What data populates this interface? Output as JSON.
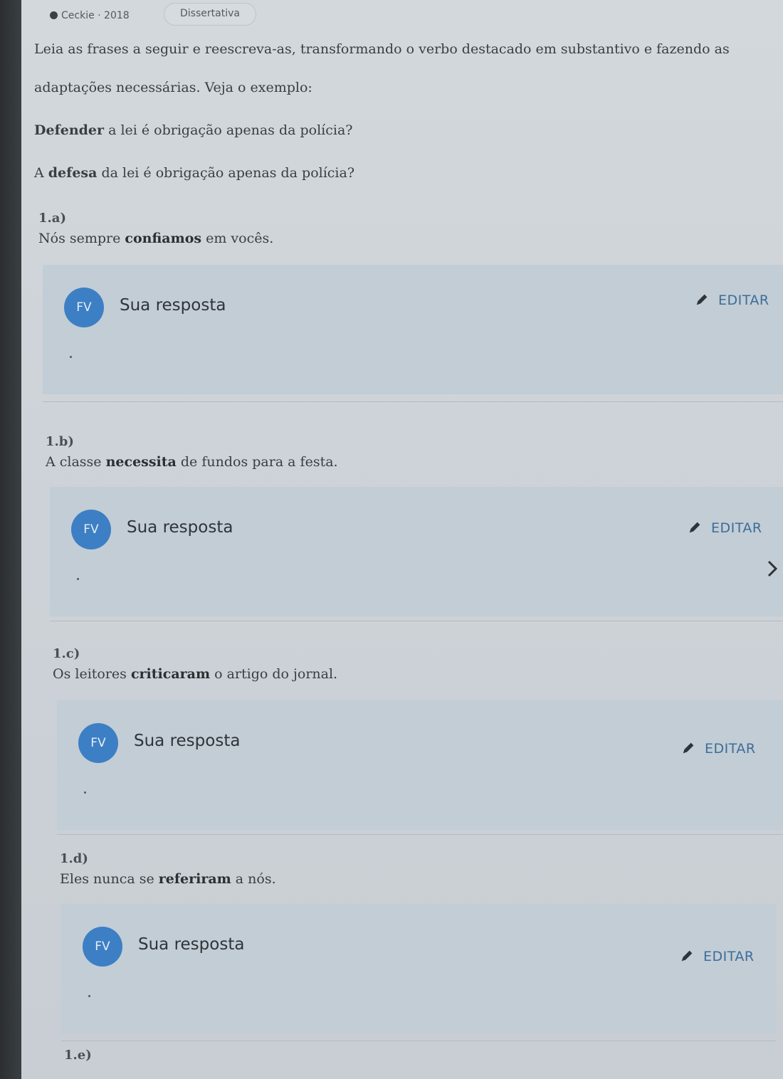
{
  "header": {
    "course": "Ceckie · 2018",
    "type_pill": "Dissertativa"
  },
  "instructions": {
    "line1": "Leia as frases a seguir e reescreva-as, transformando o verbo destacado em substantivo e fazendo as",
    "line2": "adaptações necessárias. Veja o exemplo:",
    "example_q_bold": "Defender",
    "example_q_rest": " a lei é obrigação apenas da polícia?",
    "example_a_pre": "A ",
    "example_a_bold": "defesa",
    "example_a_rest": " da lei é obrigação apenas da polícia?"
  },
  "questions": [
    {
      "label": "1.a)",
      "pre": "Nós sempre ",
      "bold": "confiamos",
      "post": " em vocês."
    },
    {
      "label": "1.b)",
      "pre": "A classe ",
      "bold": "necessita",
      "post": " de fundos para a festa."
    },
    {
      "label": "1.c)",
      "pre": "Os leitores ",
      "bold": "criticaram",
      "post": " o artigo do jornal."
    },
    {
      "label": "1.d)",
      "pre": "Eles nunca se ",
      "bold": "referiram",
      "post": " a nós."
    },
    {
      "label": "1.e)",
      "pre": "",
      "bold": "",
      "post": ""
    }
  ],
  "answer": {
    "avatar": "FV",
    "title": "Sua resposta",
    "edit_label": "EDITAR"
  },
  "colors": {
    "accent": "#3d7fc4",
    "card_bg": "#c2cdd6",
    "edit_text": "#3d6d97"
  }
}
